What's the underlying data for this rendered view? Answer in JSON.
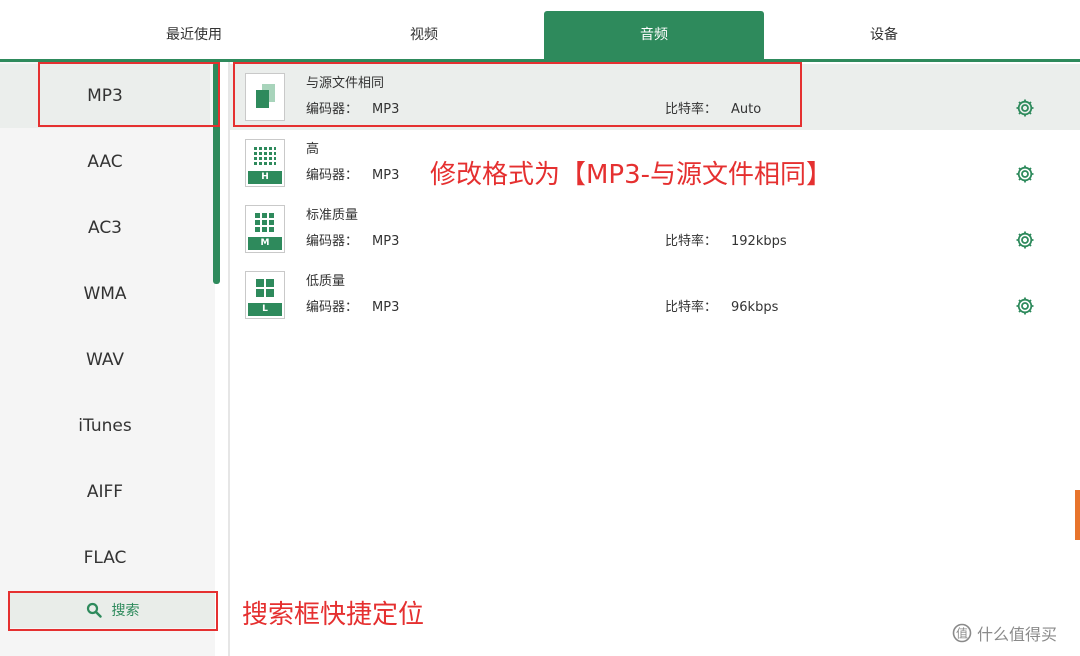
{
  "tabs": [
    {
      "label": "最近使用"
    },
    {
      "label": "视频"
    },
    {
      "label": "音频"
    },
    {
      "label": "设备"
    }
  ],
  "sidebar": {
    "items": [
      {
        "label": "MP3"
      },
      {
        "label": "AAC"
      },
      {
        "label": "AC3"
      },
      {
        "label": "WMA"
      },
      {
        "label": "WAV"
      },
      {
        "label": "iTunes"
      },
      {
        "label": "AIFF"
      },
      {
        "label": "FLAC"
      }
    ],
    "search_label": "搜索"
  },
  "presets": [
    {
      "title": "与源文件相同",
      "encoder_label": "编码器：",
      "encoder": "MP3",
      "bitrate_label": "比特率：",
      "bitrate": "Auto",
      "badge": ""
    },
    {
      "title": "高",
      "encoder_label": "编码器：",
      "encoder": "MP3",
      "bitrate_label": "",
      "bitrate": "",
      "badge": "H"
    },
    {
      "title": "标准质量",
      "encoder_label": "编码器：",
      "encoder": "MP3",
      "bitrate_label": "比特率：",
      "bitrate": "192kbps",
      "badge": "M"
    },
    {
      "title": "低质量",
      "encoder_label": "编码器：",
      "encoder": "MP3",
      "bitrate_label": "比特率：",
      "bitrate": "96kbps",
      "badge": "L"
    }
  ],
  "annotations": {
    "format_note": "修改格式为【MP3-与源文件相同】",
    "search_note": "搜索框快捷定位"
  },
  "watermark": "什么值得买",
  "colors": {
    "accent": "#2e8a5c",
    "annotation": "#e53030"
  }
}
